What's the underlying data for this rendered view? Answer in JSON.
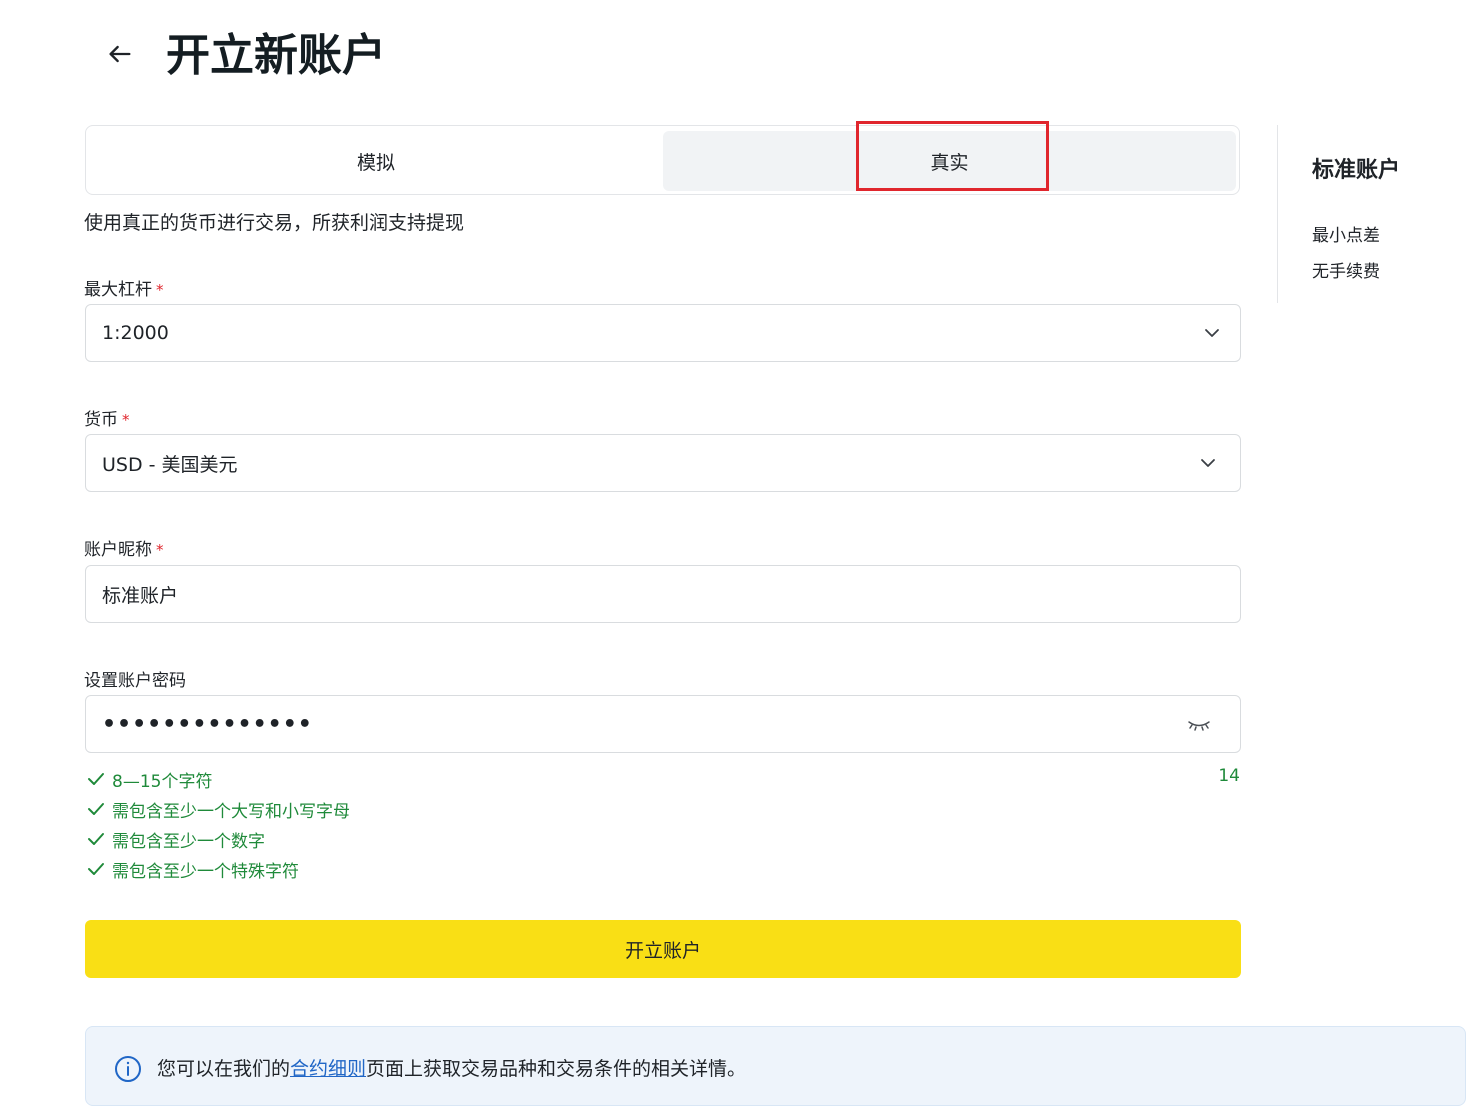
{
  "header": {
    "title": "开立新账户"
  },
  "tabs": [
    {
      "label": "模拟",
      "selected": false
    },
    {
      "label": "真实",
      "selected": true
    }
  ],
  "tab_description": "使用真正的货币进行交易，所获利润支持提现",
  "form": {
    "leverage": {
      "label": "最大杠杆",
      "required_mark": "*",
      "value": "1:2000"
    },
    "currency": {
      "label": "货币",
      "required_mark": "*",
      "value": "USD - 美国美元"
    },
    "nickname": {
      "label": "账户昵称",
      "required_mark": "*",
      "value": "标准账户"
    },
    "password": {
      "label": "设置账户密码",
      "value": "••••••••••••••",
      "char_count": "14"
    }
  },
  "password_rules": [
    {
      "text": "8—15个字符",
      "satisfied": true
    },
    {
      "text": "需包含至少一个大写和小写字母",
      "satisfied": true
    },
    {
      "text": "需包含至少一个数字",
      "satisfied": true
    },
    {
      "text": "需包含至少一个特殊字符",
      "satisfied": true
    }
  ],
  "submit_label": "开立账户",
  "info": {
    "prefix": "您可以在我们的",
    "link": "合约细则",
    "suffix": "页面上获取交易品种和交易条件的相关详情。"
  },
  "sidebar": {
    "title": "标准账户",
    "features": [
      "最小点差",
      "无手续费"
    ]
  },
  "colors": {
    "accent_yellow": "#f9df15",
    "success_green": "#1f8a3a",
    "highlight_red": "#e0262d",
    "link_blue": "#2066c6",
    "info_bg": "#eef4fb"
  },
  "icons": {
    "back": "arrow-left-icon",
    "dropdown": "chevron-down-icon",
    "password_toggle": "eye-closed-icon",
    "rule_check": "check-icon",
    "info": "info-circle-icon"
  }
}
